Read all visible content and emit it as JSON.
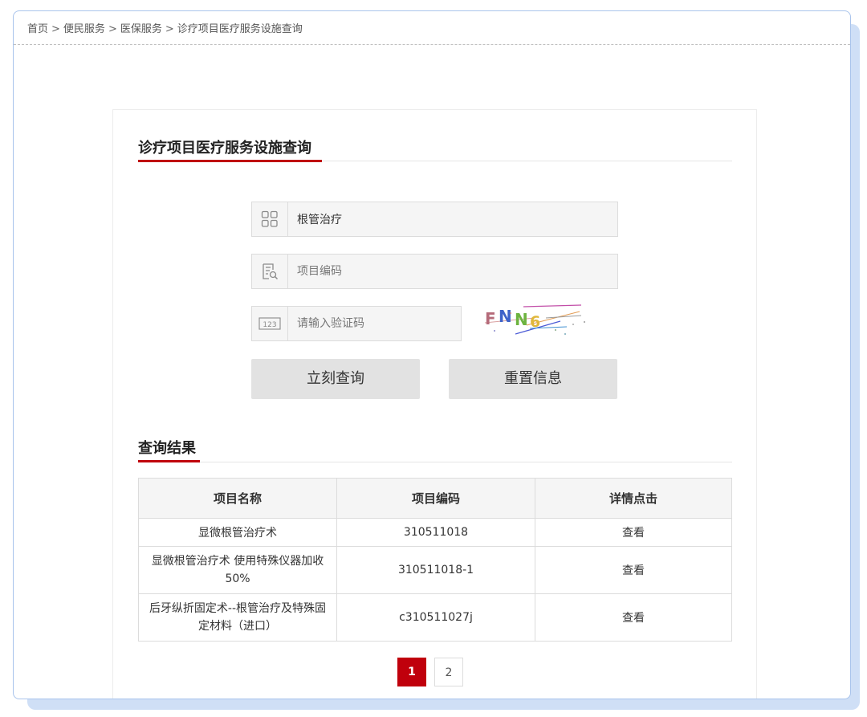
{
  "breadcrumb": {
    "items": [
      "首页",
      "便民服务",
      "医保服务",
      "诊疗项目医疗服务设施查询"
    ],
    "separators": [
      ">",
      ">",
      ">"
    ]
  },
  "search_section": {
    "title": "诊疗项目医疗服务设施查询",
    "name_input": {
      "value": "根管治疗",
      "icon": "grid-icon"
    },
    "code_input": {
      "placeholder": "项目编码",
      "icon": "document-search-icon"
    },
    "captcha_input": {
      "placeholder": "请输入验证码",
      "icon": "number-123-icon"
    },
    "captcha_text": "FNN6",
    "search_button": "立刻查询",
    "reset_button": "重置信息"
  },
  "results_section": {
    "title": "查询结果",
    "columns": [
      "项目名称",
      "项目编码",
      "详情点击"
    ],
    "rows": [
      {
        "name": "显微根管治疗术",
        "code": "310511018",
        "action": "查看"
      },
      {
        "name": "显微根管治疗术 使用特殊仪器加收50%",
        "code": "310511018-1",
        "action": "查看"
      },
      {
        "name": "后牙纵折固定术--根管治疗及特殊固定材料（进口）",
        "code": "c310511027j",
        "action": "查看"
      }
    ]
  },
  "pagination": {
    "pages": [
      "1",
      "2"
    ],
    "current": "1"
  },
  "colors": {
    "accent": "#c0000c",
    "border": "#a9c4ec",
    "button_bg": "#e2e2e2"
  }
}
